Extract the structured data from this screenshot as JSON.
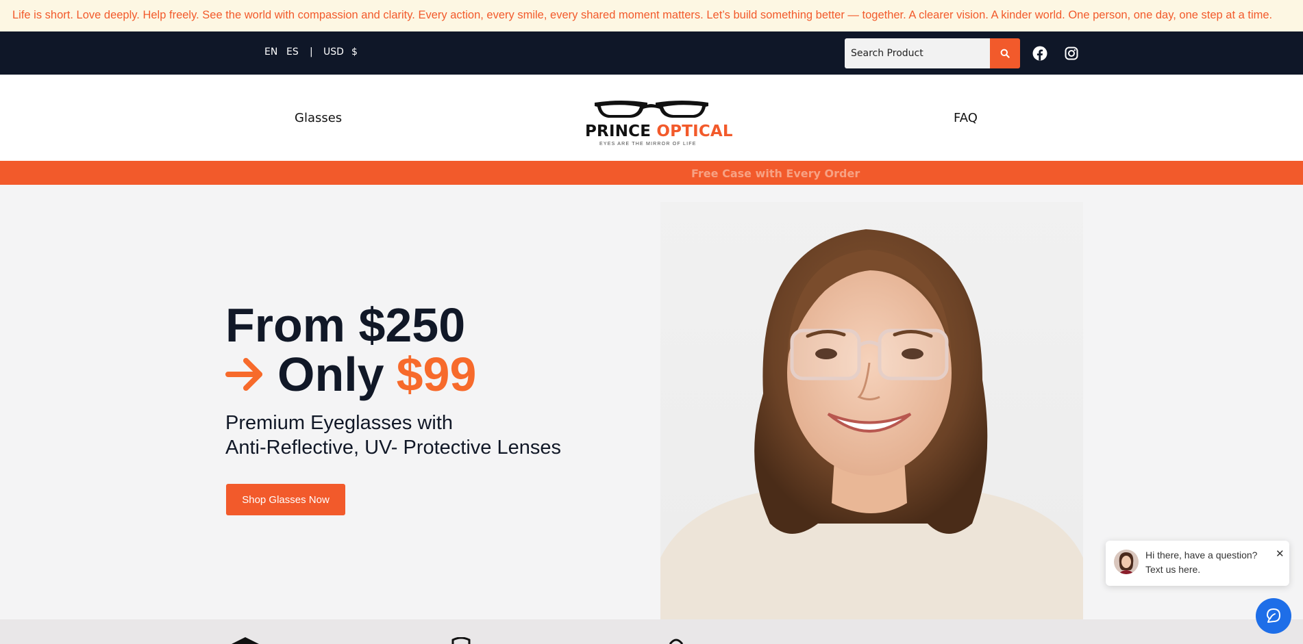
{
  "announcement": {
    "text": "Life is short. Love deeply. Help freely. See the world with compassion and clarity. Every action, every smile, every shared moment matters. Let’s build something better — together. A clearer vision. A kinder world. One person, one day, one step at a time."
  },
  "topbar": {
    "languages": [
      "EN",
      "ES"
    ],
    "separator": "|",
    "currency_code": "USD",
    "currency_symbol": "$",
    "search": {
      "placeholder": "Search Product"
    },
    "social": [
      "facebook-icon",
      "instagram-icon"
    ]
  },
  "header": {
    "nav_left": "Glasses",
    "nav_right": "FAQ",
    "logo": {
      "brand_first": "PRINCE",
      "brand_second": "OPTICAL",
      "tagline": "EYES ARE THE MIRROR OF LIFE"
    }
  },
  "promo": {
    "text": "Free Case with Every Order"
  },
  "hero": {
    "line1": "From $250",
    "line2_prefix": "Only",
    "line2_price": "$99",
    "subtitle_line1": "Premium Eyeglasses with",
    "subtitle_line2": "Anti-Reflective, UV- Protective Lenses",
    "cta_label": "Shop Glasses Now"
  },
  "chat": {
    "line1": "Hi there, have a question?",
    "line2": "Text us here.",
    "close": "✕"
  },
  "colors": {
    "accent": "#f25a2b",
    "dark": "#0f1728",
    "announcement_bg": "#fdf7e3",
    "chat_blue": "#1e6ee8"
  }
}
